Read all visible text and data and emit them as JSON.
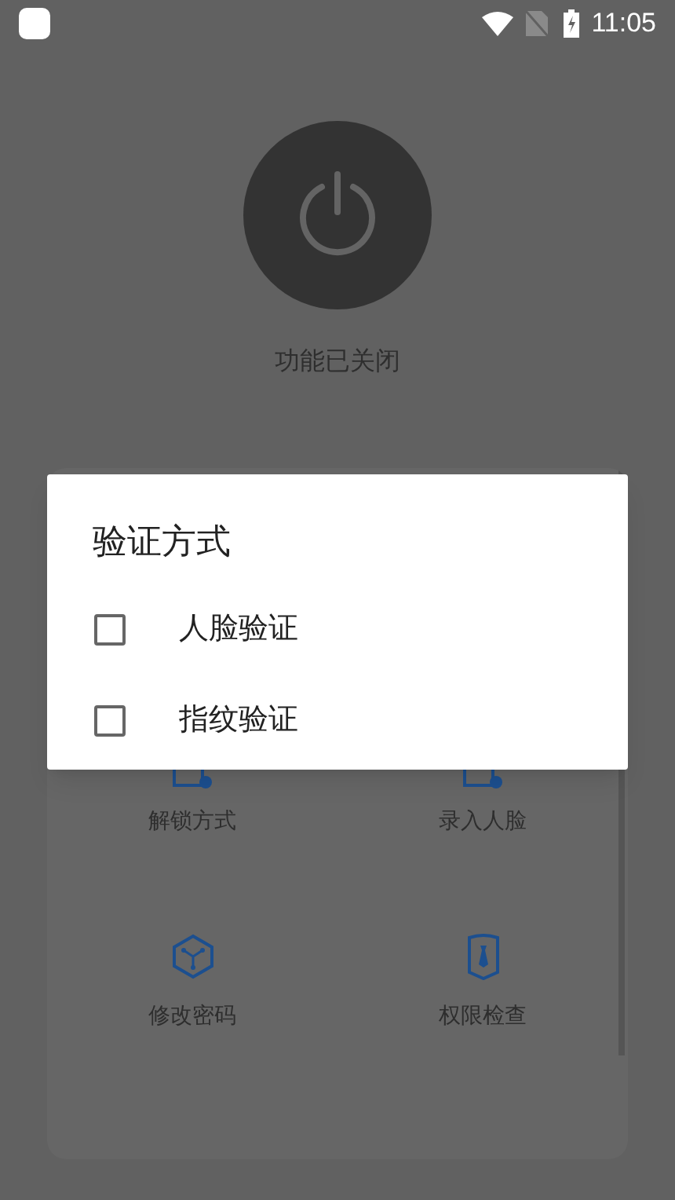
{
  "status_bar": {
    "time": "11:05"
  },
  "power": {
    "on": false,
    "label": "功能已关闭"
  },
  "grid": {
    "items": [
      {
        "kind": "unlock",
        "label": "解锁方式"
      },
      {
        "kind": "face",
        "label": "录入人脸"
      },
      {
        "kind": "password",
        "label": "修改密码"
      },
      {
        "kind": "permission",
        "label": "权限检查"
      }
    ]
  },
  "dialog": {
    "title": "验证方式",
    "options": [
      {
        "label": "人脸验证",
        "checked": false
      },
      {
        "label": "指纹验证",
        "checked": false
      }
    ]
  }
}
